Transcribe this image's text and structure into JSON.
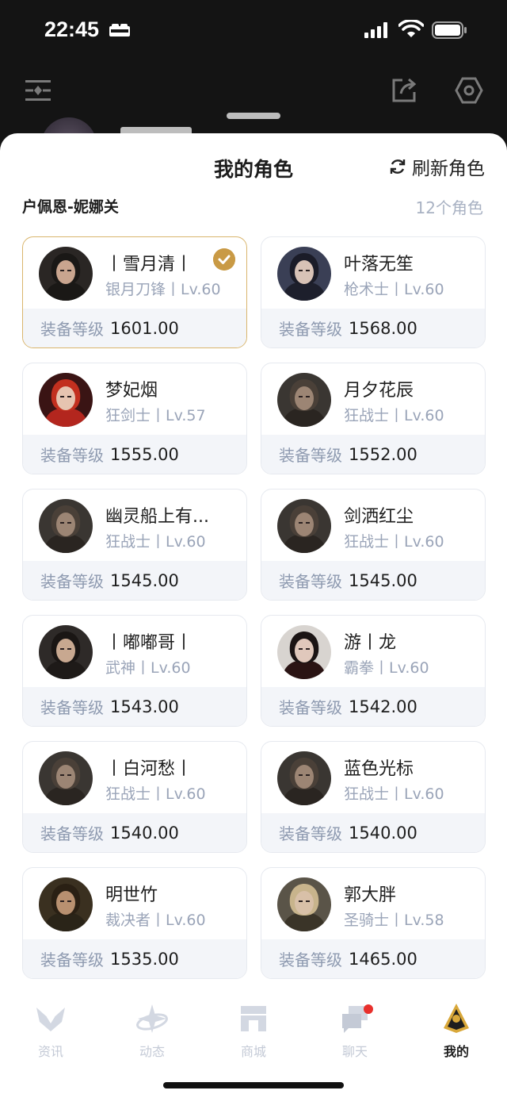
{
  "status_bar": {
    "time": "22:45"
  },
  "sheet": {
    "title": "我的角色",
    "refresh_label": "刷新角色",
    "server_name": "户佩恩-妮娜关",
    "character_count": "12个角色"
  },
  "characters": [
    {
      "name": "丨雪月清丨",
      "class": "银月刀锋丨Lv.60",
      "gear_label": "装备等级",
      "gear_score": "1601.00",
      "selected": true,
      "avatar": "hooded-female"
    },
    {
      "name": "叶落无笙",
      "class": "枪术士丨Lv.60",
      "gear_label": "装备等级",
      "gear_score": "1568.00",
      "avatar": "dark-hair-female"
    },
    {
      "name": "梦妃烟",
      "class": "狂剑士丨Lv.57",
      "gear_label": "装备等级",
      "gear_score": "1555.00",
      "avatar": "red-hair-female"
    },
    {
      "name": "月夕花辰",
      "class": "狂战士丨Lv.60",
      "gear_label": "装备等级",
      "gear_score": "1552.00",
      "avatar": "berserker-male"
    },
    {
      "name": "幽灵船上有...",
      "class": "狂战士丨Lv.60",
      "gear_label": "装备等级",
      "gear_score": "1545.00",
      "avatar": "berserker-male"
    },
    {
      "name": "剑洒红尘",
      "class": "狂战士丨Lv.60",
      "gear_label": "装备等级",
      "gear_score": "1545.00",
      "avatar": "berserker-male"
    },
    {
      "name": "丨嘟嘟哥丨",
      "class": "武神丨Lv.60",
      "gear_label": "装备等级",
      "gear_score": "1543.00",
      "avatar": "warrior-male"
    },
    {
      "name": "游丨龙",
      "class": "霸拳丨Lv.60",
      "gear_label": "装备等级",
      "gear_score": "1542.00",
      "avatar": "fighter-female"
    },
    {
      "name": "丨白河愁丨",
      "class": "狂战士丨Lv.60",
      "gear_label": "装备等级",
      "gear_score": "1540.00",
      "avatar": "berserker-male"
    },
    {
      "name": "蓝色光标",
      "class": "狂战士丨Lv.60",
      "gear_label": "装备等级",
      "gear_score": "1540.00",
      "avatar": "berserker-male"
    },
    {
      "name": "明世竹",
      "class": "裁决者丨Lv.60",
      "gear_label": "装备等级",
      "gear_score": "1535.00",
      "avatar": "judge-male"
    },
    {
      "name": "郭大胖",
      "class": "圣骑士丨Lv.58",
      "gear_label": "装备等级",
      "gear_score": "1465.00",
      "avatar": "paladin-male"
    }
  ],
  "tabs": [
    {
      "label": "资讯",
      "icon": "news-icon",
      "active": false
    },
    {
      "label": "动态",
      "icon": "feed-icon",
      "active": false
    },
    {
      "label": "商城",
      "icon": "shop-icon",
      "active": false
    },
    {
      "label": "聊天",
      "icon": "chat-icon",
      "active": false,
      "badge": true
    },
    {
      "label": "我的",
      "icon": "profile-icon",
      "active": true
    }
  ],
  "colors": {
    "accent_gold": "#c99a45",
    "selected_border": "#d9b56c",
    "muted_text": "#9aa4b8",
    "badge_red": "#e8302c"
  }
}
